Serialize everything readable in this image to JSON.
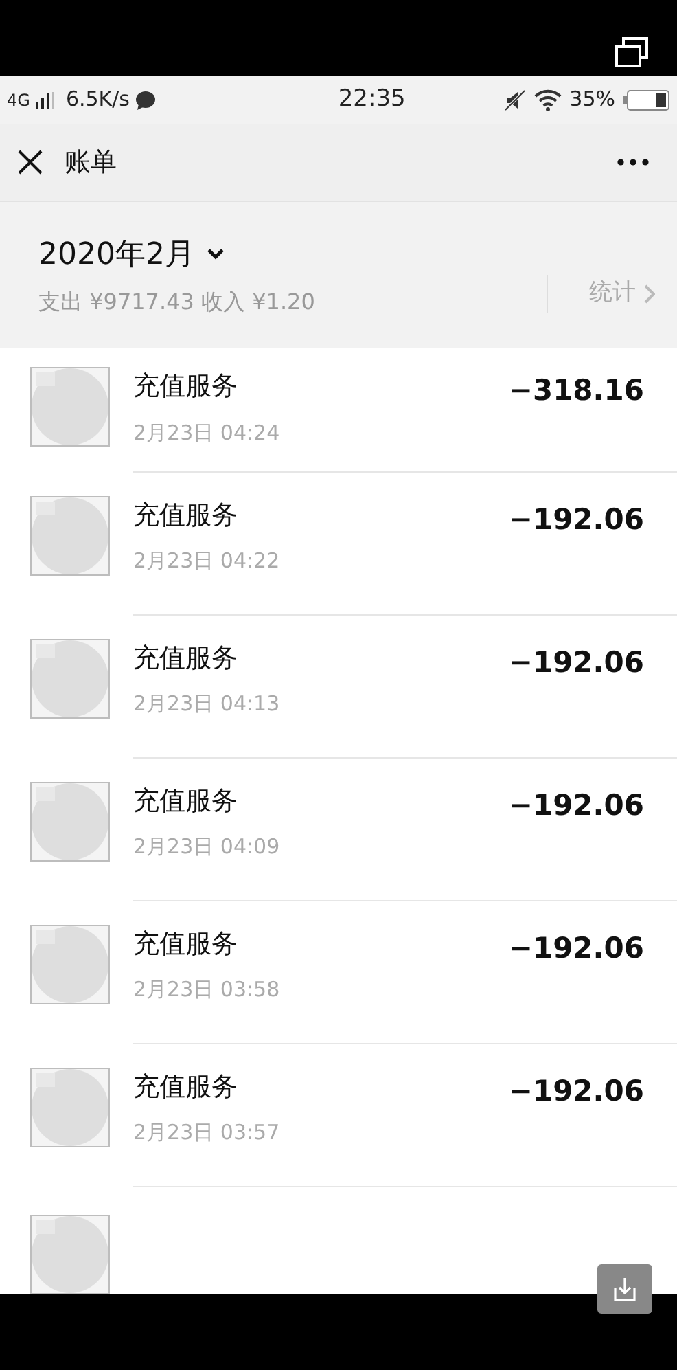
{
  "status_bar": {
    "network": "4G",
    "speed": "6.5K/s",
    "time": "22:35",
    "battery": "35%"
  },
  "nav": {
    "title": "账单"
  },
  "summary": {
    "month": "2020年2月",
    "totals": "支出 ¥9717.43 收入 ¥1.20",
    "stats_link": "统计"
  },
  "transactions": [
    {
      "title": "充值服务",
      "time": "2月23日 04:24",
      "amount": "−318.16"
    },
    {
      "title": "充值服务",
      "time": "2月23日 04:22",
      "amount": "−192.06"
    },
    {
      "title": "充值服务",
      "time": "2月23日 04:13",
      "amount": "−192.06"
    },
    {
      "title": "充值服务",
      "time": "2月23日 04:09",
      "amount": "−192.06"
    },
    {
      "title": "充值服务",
      "time": "2月23日 03:58",
      "amount": "−192.06"
    },
    {
      "title": "充值服务",
      "time": "2月23日 03:57",
      "amount": "−192.06"
    }
  ]
}
